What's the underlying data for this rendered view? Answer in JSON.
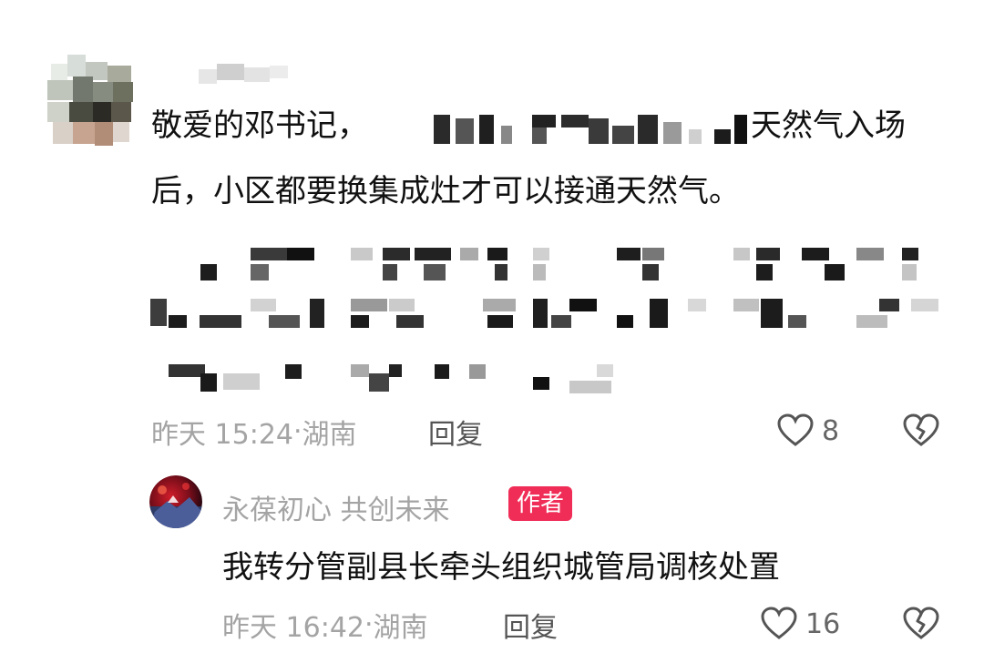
{
  "comment": {
    "text_part1": "敬爱的邓书记，",
    "text_part2": "天然气入场",
    "text_line2": "后，小区都要换集成灶才可以接通天然气。",
    "time": "昨天 15:24",
    "location": "湖南",
    "reply_label": "回复",
    "likes": "8"
  },
  "reply": {
    "author": "永葆初心  共创未来",
    "badge": "作者",
    "text": "我转分管副县长牵头组织城管局调核处置",
    "time": "昨天 16:42",
    "location": "湖南",
    "reply_label": "回复",
    "likes": "16"
  },
  "colors": {
    "meta_gray": "#a4a4a4",
    "badge_red": "#f02d57",
    "text_dark": "#111111"
  },
  "icons": {
    "like": "heart-outline-icon",
    "dislike": "broken-heart-icon"
  }
}
